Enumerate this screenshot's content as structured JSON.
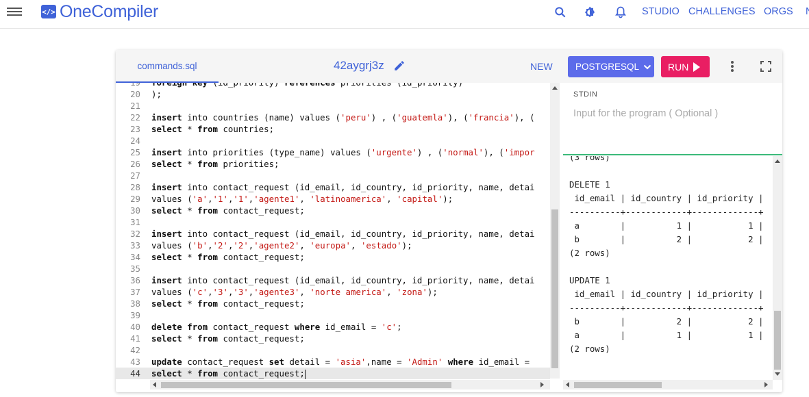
{
  "app": {
    "name": "OneCompiler",
    "logo_glyph": "</>",
    "nav_links": [
      "STUDIO",
      "CHALLENGES",
      "ORGS",
      "N"
    ]
  },
  "editor": {
    "file_tab": "commands.sql",
    "project_name": "42aygrj3z",
    "new_label": "NEW",
    "language_label": "POSTGRESQL",
    "run_label": "RUN",
    "code_lines": [
      {
        "n": "19",
        "html": "<span class=\"kw\">foreign</span> <span class=\"kw\">key</span> (id_priority) <span class=\"kw\">references</span> priorities (id_priority)"
      },
      {
        "n": "20",
        "html": ");"
      },
      {
        "n": "21",
        "html": ""
      },
      {
        "n": "22",
        "html": "<span class=\"kw\">insert</span> into countries (name) values (<span class=\"str\">'peru'</span>) , (<span class=\"str\">'guatemla'</span>), (<span class=\"str\">'francia'</span>), ("
      },
      {
        "n": "23",
        "html": "<span class=\"kw\">select</span> * <span class=\"kw\">from</span> countries;"
      },
      {
        "n": "24",
        "html": ""
      },
      {
        "n": "25",
        "html": "<span class=\"kw\">insert</span> into priorities (type_name) values (<span class=\"str\">'urgente'</span>) , (<span class=\"str\">'normal'</span>), (<span class=\"str\">'impor</span>"
      },
      {
        "n": "26",
        "html": "<span class=\"kw\">select</span> * <span class=\"kw\">from</span> priorities;"
      },
      {
        "n": "27",
        "html": ""
      },
      {
        "n": "28",
        "html": "<span class=\"kw\">insert</span> into contact_request (id_email, id_country, id_priority, name, detai"
      },
      {
        "n": "29",
        "html": "values (<span class=\"str\">'a'</span>,<span class=\"str\">'1'</span>,<span class=\"str\">'1'</span>,<span class=\"str\">'agente1'</span>, <span class=\"str\">'latinoamerica'</span>, <span class=\"str\">'capital'</span>);"
      },
      {
        "n": "30",
        "html": "<span class=\"kw\">select</span> * <span class=\"kw\">from</span> contact_request;"
      },
      {
        "n": "31",
        "html": ""
      },
      {
        "n": "32",
        "html": "<span class=\"kw\">insert</span> into contact_request (id_email, id_country, id_priority, name, detai"
      },
      {
        "n": "33",
        "html": "values (<span class=\"str\">'b'</span>,<span class=\"str\">'2'</span>,<span class=\"str\">'2'</span>,<span class=\"str\">'agente2'</span>, <span class=\"str\">'europa'</span>, <span class=\"str\">'estado'</span>);"
      },
      {
        "n": "34",
        "html": "<span class=\"kw\">select</span> * <span class=\"kw\">from</span> contact_request;"
      },
      {
        "n": "35",
        "html": ""
      },
      {
        "n": "36",
        "html": "<span class=\"kw\">insert</span> into contact_request (id_email, id_country, id_priority, name, detai"
      },
      {
        "n": "37",
        "html": "values (<span class=\"str\">'c'</span>,<span class=\"str\">'3'</span>,<span class=\"str\">'3'</span>,<span class=\"str\">'agente3'</span>, <span class=\"str\">'norte america'</span>, <span class=\"str\">'zona'</span>);"
      },
      {
        "n": "38",
        "html": "<span class=\"kw\">select</span> * <span class=\"kw\">from</span> contact_request;"
      },
      {
        "n": "39",
        "html": ""
      },
      {
        "n": "40",
        "html": "<span class=\"kw\">delete</span> <span class=\"kw\">from</span> contact_request <span class=\"kw\">where</span> id_email = <span class=\"str\">'c'</span>;"
      },
      {
        "n": "41",
        "html": "<span class=\"kw\">select</span> * <span class=\"kw\">from</span> contact_request;"
      },
      {
        "n": "42",
        "html": ""
      },
      {
        "n": "43",
        "html": "<span class=\"kw\">update</span> contact_request <span class=\"kw\">set</span> detail = <span class=\"str\">'asia'</span>,name = <span class=\"str\">'Admin'</span> <span class=\"kw\">where</span> id_email ="
      },
      {
        "n": "44",
        "html": "<span class=\"kw\">select</span> * <span class=\"kw\">from</span> contact_request;",
        "active": true
      }
    ]
  },
  "stdin": {
    "label": "STDIN",
    "placeholder": "Input for the program ( Optional )"
  },
  "output": {
    "lines": [
      "(3 rows)",
      "",
      "DELETE 1",
      " id_email | id_country | id_priority |",
      "----------+------------+-------------+",
      " a        |          1 |           1 |",
      " b        |          2 |           2 |",
      "(2 rows)",
      "",
      "UPDATE 1",
      " id_email | id_country | id_priority |",
      "----------+------------+-------------+",
      " b        |          2 |           2 |",
      " a        |          1 |           1 |",
      "(2 rows)"
    ]
  },
  "colors": {
    "brand": "#3f62d8",
    "language_button": "#5c6bea",
    "run_button": "#e91e63",
    "divider": "#3cba7a"
  }
}
